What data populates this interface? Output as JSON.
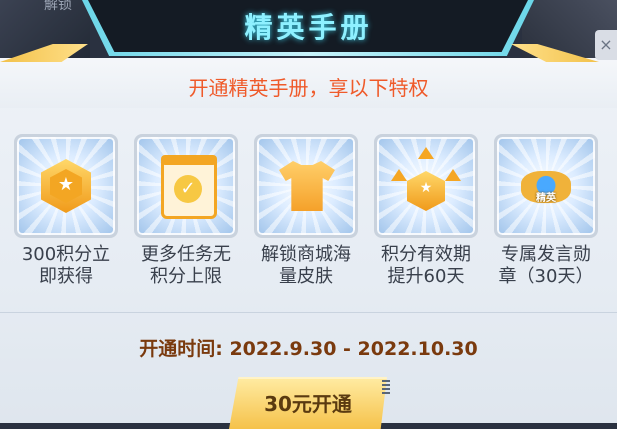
{
  "background": {
    "left_text": "解锁"
  },
  "header": {
    "title": "精英手册",
    "close_label": "×"
  },
  "subtitle": "开通精英手册，享以下特权",
  "perks": [
    {
      "icon": "gold-hex-badge-icon",
      "label_line1": "300积分立",
      "label_line2": "即获得"
    },
    {
      "icon": "calendar-check-icon",
      "label_line1": "更多任务无",
      "label_line2": "积分上限"
    },
    {
      "icon": "shirt-icon",
      "label_line1": "解锁商城海",
      "label_line2": "量皮肤"
    },
    {
      "icon": "upgrade-arrows-icon",
      "label_line1": "积分有效期",
      "label_line2": "提升60天"
    },
    {
      "icon": "elite-emblem-icon",
      "label_line1": "专属发言勋",
      "label_line2": "章（30天）",
      "emblem_text": "精英"
    }
  ],
  "period": "开通时间: 2022.9.30 - 2022.10.30",
  "purchase_button": {
    "label": "30元开通"
  },
  "colors": {
    "accent_orange": "#ef5a2a",
    "title_cyan": "#8ef0ff",
    "button_gold": "#f5c24a",
    "period_brown": "#7a3a0e"
  }
}
